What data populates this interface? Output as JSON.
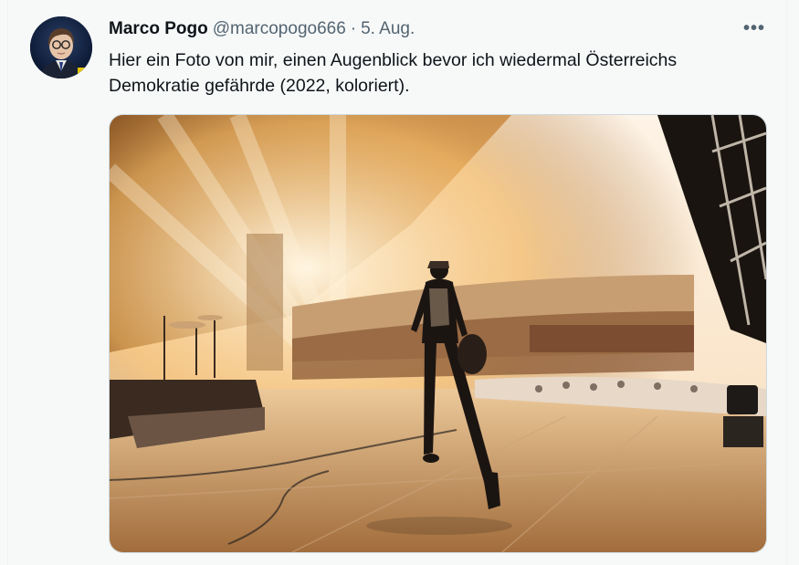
{
  "tweet": {
    "display_name": "Marco Pogo",
    "handle": "@marcopogo666",
    "separator": "·",
    "date": "5. Aug.",
    "more_label": "•••",
    "text": "Hier ein Foto von mir, einen Augenblick bevor ich wiedermal Österreichs Demokratie gefährde (2022, koloriert).",
    "avatar_icon": "profile-photo",
    "media_icon": "concert-stage-photo"
  },
  "colors": {
    "text_primary": "#0f1419",
    "text_secondary": "#536471",
    "background": "#f7f9f9",
    "border": "#cfd9de"
  }
}
